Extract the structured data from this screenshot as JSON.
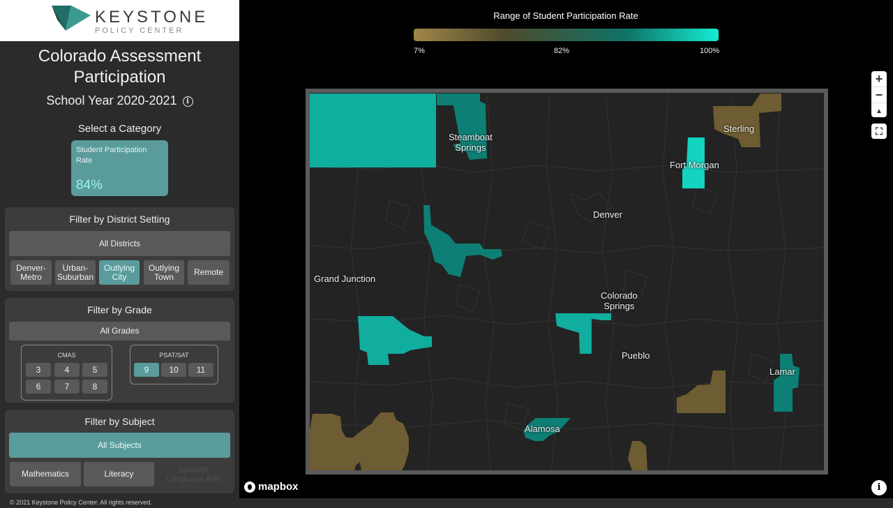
{
  "logo": {
    "name": "KEYSTONE",
    "sub": "POLICY CENTER"
  },
  "sidebar": {
    "title_line1": "Colorado Assessment",
    "title_line2": "Participation",
    "school_year": "School Year 2020-2021",
    "info_icon": "i",
    "category_heading": "Select a Category",
    "category_card": {
      "name": "Student Participation Rate",
      "value": "84%"
    }
  },
  "district_filter": {
    "title": "Filter by District Setting",
    "all_label": "All Districts",
    "options": [
      {
        "line1": "Denver-",
        "line2": "Metro",
        "active": false
      },
      {
        "line1": "Urban-",
        "line2": "Suburban",
        "active": false
      },
      {
        "line1": "Outlying",
        "line2": "City",
        "active": true
      },
      {
        "line1": "Outlying",
        "line2": "Town",
        "active": false
      },
      {
        "line1": "Remote",
        "line2": "",
        "active": false
      }
    ]
  },
  "grade_filter": {
    "title": "Filter by Grade",
    "all_label": "All Grades",
    "cmas_label": "CMAS",
    "cmas_grades": [
      "3",
      "4",
      "5",
      "6",
      "7",
      "8"
    ],
    "psat_label": "PSAT/SAT",
    "psat_grades": [
      "9",
      "10",
      "11"
    ],
    "active_grade": "9"
  },
  "subject_filter": {
    "title": "Filter by Subject",
    "all_label": "All Subjects",
    "math_label": "Mathematics",
    "literacy_label": "Literacy",
    "spanish_line1": "Spanish",
    "spanish_line2": "Language Arts"
  },
  "footer": {
    "copyright": "© 2021 Keystone Policy Center. All rights reserved."
  },
  "legend": {
    "title": "Range of Student Participation Rate",
    "min_label": "7%",
    "mid_label": "82%",
    "max_label": "100%",
    "colors": [
      "#a1864a",
      "#4e4a2c",
      "#0f7467",
      "#15ecd4"
    ]
  },
  "cities": {
    "steamboat_1": "Steamboat",
    "steamboat_2": "Springs",
    "fort_morgan": "Fort Morgan",
    "sterling": "Sterling",
    "denver": "Denver",
    "grand_junction": "Grand Junction",
    "colorado_springs_1": "Colorado",
    "colorado_springs_2": "Springs",
    "pueblo": "Pueblo",
    "lamar": "Lamar",
    "alamosa": "Alamosa"
  },
  "map_controls": {
    "zoom_in": "+",
    "zoom_out": "−",
    "compass": "▲",
    "fullscreen": "⛶",
    "attribution": "i"
  },
  "mapbox": {
    "label": "mapbox"
  },
  "colors": {
    "accent": "#5a9b9c",
    "high": "#11ad9e",
    "mid": "#0e7f74",
    "low": "#6e5c32"
  }
}
